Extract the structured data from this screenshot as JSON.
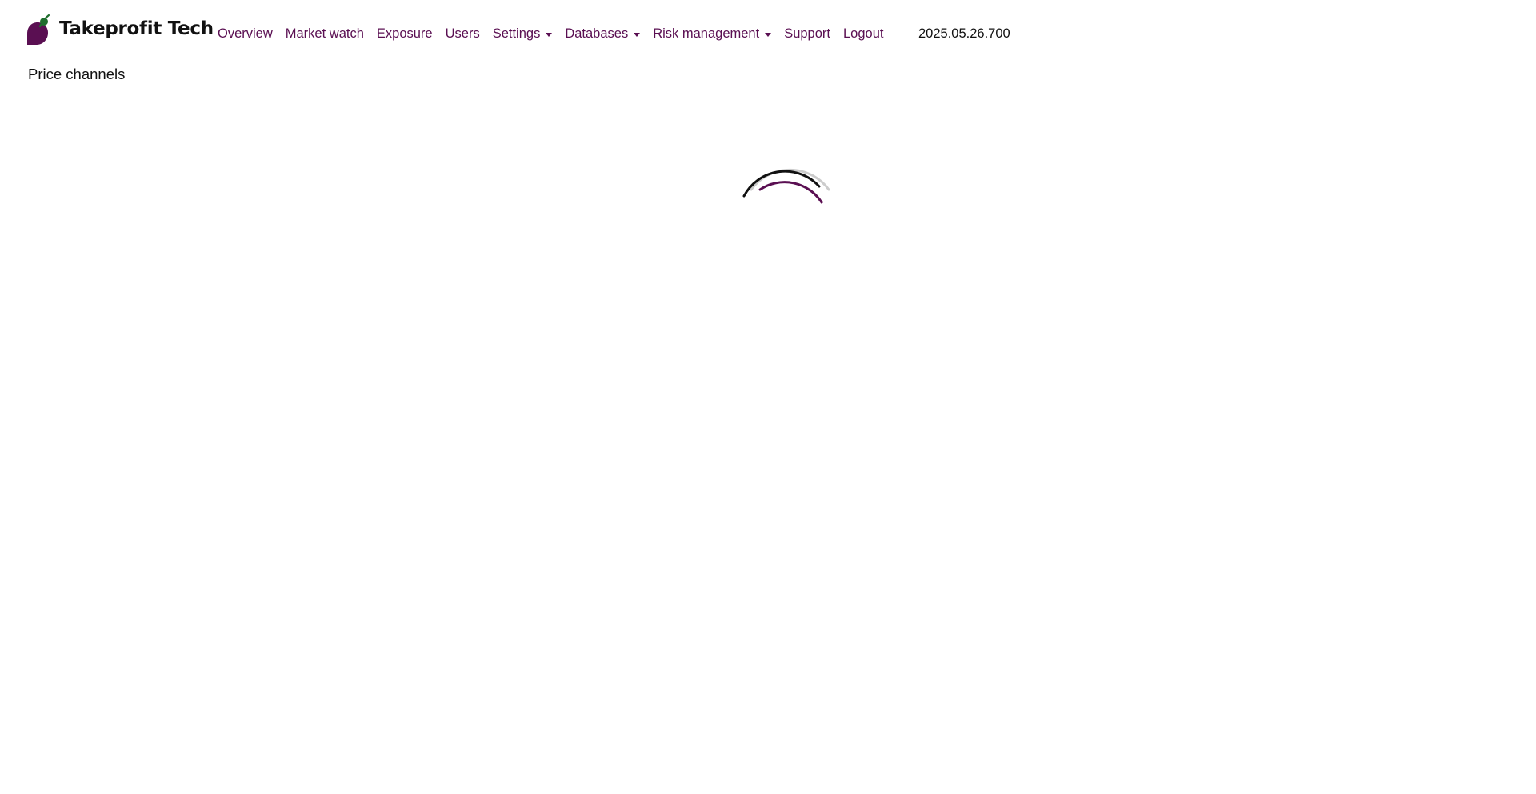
{
  "brand": {
    "name": "Takeprofit Tech",
    "logo_icon": "takeprofit-leaf-logo-icon",
    "colors": {
      "primary": "#5a0f52",
      "leaf": "#1f6e2e"
    }
  },
  "nav": {
    "items": [
      {
        "label": "Overview",
        "dropdown": false
      },
      {
        "label": "Market watch",
        "dropdown": false
      },
      {
        "label": "Exposure",
        "dropdown": false
      },
      {
        "label": "Users",
        "dropdown": false
      },
      {
        "label": "Settings",
        "dropdown": true
      },
      {
        "label": "Databases",
        "dropdown": true
      },
      {
        "label": "Risk management",
        "dropdown": true
      },
      {
        "label": "Support",
        "dropdown": false
      },
      {
        "label": "Logout",
        "dropdown": false
      }
    ],
    "link_color": "#5a0f52"
  },
  "version": "2025.05.26.700",
  "page": {
    "title": "Price channels"
  },
  "loader": {
    "icon": "loading-spinner-icon",
    "colors": [
      "#cccccc",
      "#111111",
      "#5a0f52"
    ]
  }
}
